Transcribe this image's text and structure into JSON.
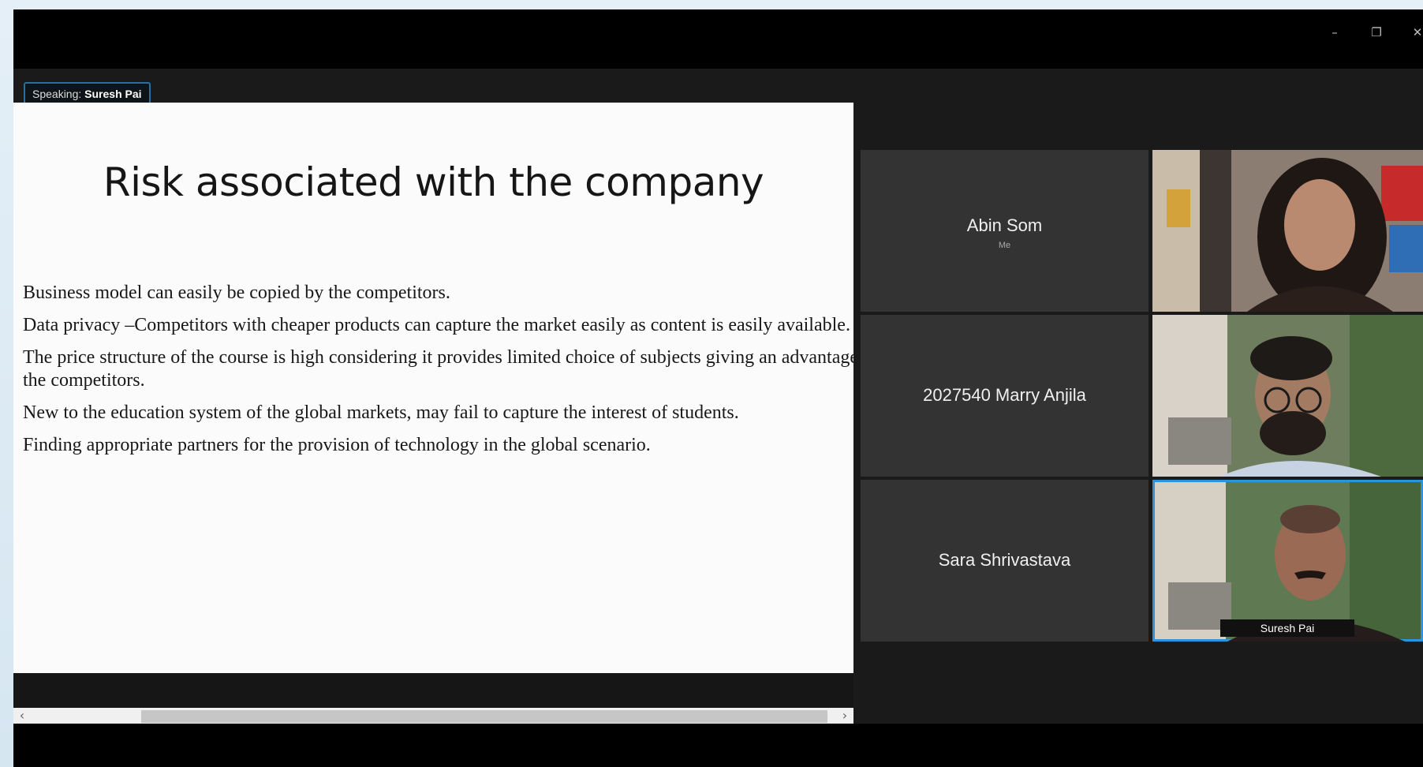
{
  "window": {
    "controls": {
      "minimize": "–",
      "restore": "❐",
      "close": "✕"
    }
  },
  "speaking": {
    "prefix": "Speaking:",
    "name": "Suresh Pai"
  },
  "slide": {
    "title": "Risk associated with the company",
    "bullets": [
      "Business model can easily be copied by the competitors.",
      "Data privacy –Competitors  with cheaper products can capture the market easily as content is easily available.",
      "The price structure of the course is high considering it provides limited choice of subjects giving an advantage for the competitors.",
      "New to the education system of the global markets, may fail to capture the interest of students.",
      "Finding appropriate partners for the provision of technology in the global scenario."
    ]
  },
  "scrollbar": {
    "left_arrow": "‹",
    "right_arrow": "›"
  },
  "participants": {
    "abin": {
      "name": "Abin Som",
      "sub": "Me"
    },
    "marry": {
      "name": "2027540 Marry Anjila"
    },
    "sara": {
      "name": "Sara Shrivastava"
    },
    "suresh": {
      "tag": "Suresh Pai"
    }
  },
  "colors": {
    "speaker_highlight": "#2d93dc",
    "tile_bg": "#333333"
  }
}
